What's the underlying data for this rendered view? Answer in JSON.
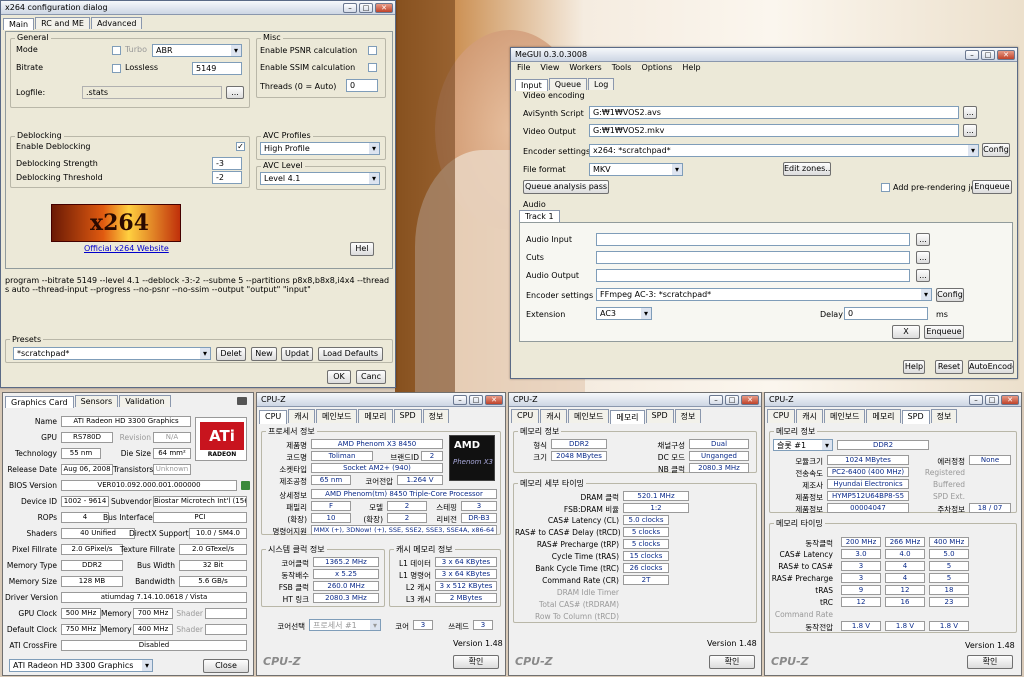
{
  "x264": {
    "title": "x264 configuration dialog",
    "tabs": [
      "Main",
      "RC and ME",
      "Advanced"
    ],
    "general": "General",
    "mode_label": "Mode",
    "turbo": "Turbo",
    "mode_value": "ABR",
    "bitrate_label": "Bitrate",
    "lossless": "Lossless",
    "bitrate_value": "5149",
    "logfile_label": "Logfile:",
    "logfile_value": ".stats",
    "browse": "...",
    "misc": "Misc",
    "psnr": "Enable PSNR calculation",
    "ssim": "Enable SSIM calculation",
    "threads_label": "Threads (0 = Auto)",
    "threads_value": "0",
    "deblocking": "Deblocking",
    "enable_deblock": "Enable Deblocking",
    "strength_label": "Deblocking Strength",
    "strength_value": "-3",
    "threshold_label": "Deblocking Threshold",
    "threshold_value": "-2",
    "avc_profiles": "AVC Profiles",
    "profile_value": "High Profile",
    "avc_level": "AVC Level",
    "level_value": "Level 4.1",
    "logo": "x264",
    "website": "Official x264 Website",
    "help": "Hel",
    "cmdline": "program --bitrate 5149 --level 4.1 --deblock -3:-2 --subme 5 --partitions p8x8,b8x8,i4x4 --threads auto --thread-input --progress --no-psnr --no-ssim --output \"output\" \"input\"",
    "presets": "Presets",
    "preset_value": "*scratchpad*",
    "delete": "Delet",
    "new": "New",
    "update": "Updat",
    "load_defaults": "Load Defaults",
    "ok": "OK",
    "cancel": "Canc"
  },
  "megui": {
    "title": "MeGUI 0.3.0.3008",
    "menu": [
      "File",
      "View",
      "Workers",
      "Tools",
      "Options",
      "Help"
    ],
    "tabs": [
      "Input",
      "Queue",
      "Log"
    ],
    "video_encoding": "Video encoding",
    "avisynth_label": "AviSynth Script",
    "avisynth_value": "G:₩1₩VOS2.avs",
    "video_output_label": "Video Output",
    "video_output_value": "G:₩1₩VOS2.mkv",
    "encoder_label": "Encoder settings",
    "encoder_value": "x264: *scratchpad*",
    "config": "Config",
    "format_label": "File format",
    "format_value": "MKV",
    "edit_zones": "Edit zones...",
    "queue_analysis": "Queue analysis pass",
    "add_prerender": "Add pre-rendering job",
    "enqueue": "Enqueue",
    "audio": "Audio",
    "track": "Track 1",
    "audio_input_label": "Audio Input",
    "cuts_label": "Cuts",
    "audio_output_label": "Audio Output",
    "audio_encoder_label": "Encoder settings",
    "audio_encoder_value": "FFmpeg AC-3: *scratchpad*",
    "audio_config": "Config",
    "extension_label": "Extension",
    "extension_value": "AC3",
    "delay_label": "Delay",
    "delay_value": "0",
    "ms": "ms",
    "x": "X",
    "audio_enqueue": "Enqueue",
    "help": "Help",
    "reset": "Reset",
    "autoencode": "AutoEncode",
    "browse": "..."
  },
  "gpuz": {
    "tabs": [
      "Graphics Card",
      "Sensors",
      "Validation"
    ],
    "rows": [
      [
        "Name",
        "ATI Radeon HD 3300 Graphics"
      ],
      [
        "GPU",
        "RS780D"
      ],
      [
        "Revision",
        "N/A"
      ],
      [
        "Technology",
        "55 nm"
      ],
      [
        "Die Size",
        "64 mm²"
      ],
      [
        "Release Date",
        "Aug 06, 2008"
      ],
      [
        "Transistors",
        "Unknown"
      ],
      [
        "BIOS Version",
        "VER010.092.000.001.000000"
      ],
      [
        "Device ID",
        "1002 - 9614"
      ],
      [
        "Subvendor",
        "Biostar Microtech Int'l (1565)"
      ],
      [
        "ROPs",
        "4"
      ],
      [
        "Bus Interface",
        "PCI"
      ],
      [
        "Shaders",
        "40 Unified"
      ],
      [
        "DirectX Support",
        "10.0 / SM4.0"
      ],
      [
        "Pixel Fillrate",
        "2.0 GPixel/s"
      ],
      [
        "Texture Fillrate",
        "2.0 GTexel/s"
      ],
      [
        "Memory Type",
        "DDR2"
      ],
      [
        "Bus Width",
        "32 Bit"
      ],
      [
        "Memory Size",
        "128 MB"
      ],
      [
        "Bandwidth",
        "5.6 GB/s"
      ],
      [
        "Driver Version",
        "atiumdag 7.14.10.0618 / Vista"
      ],
      [
        "GPU Clock",
        "500 MHz"
      ],
      [
        "Memory",
        "700 MHz"
      ],
      [
        "Shader",
        ""
      ],
      [
        "Default Clock",
        "750 MHz"
      ],
      [
        "Memory2",
        "400 MHz"
      ],
      [
        "Shader2",
        ""
      ],
      [
        "ATI CrossFire",
        "Disabled"
      ]
    ],
    "labels": {
      "memory": "Memory",
      "shader": "Shader"
    },
    "ati_logo": "ATi",
    "ati_sub": "RADEON",
    "select_value": "ATI Radeon HD 3300 Graphics",
    "close": "Close"
  },
  "cpuz1": {
    "title": "CPU-Z",
    "tabs": [
      "CPU",
      "캐시",
      "메인보드",
      "메모리",
      "SPD",
      "정보"
    ],
    "proc_group": "프로세서 정보",
    "name_l": "제품명",
    "name_v": "AMD Phenom X3 8450",
    "code_l": "코드명",
    "code_v": "Toliman",
    "brand_l": "브랜드ID",
    "brand_v": "2",
    "socket_l": "소켓타입",
    "socket_v": "Socket AM2+ (940)",
    "process_l": "제조공정",
    "process_v": "65 nm",
    "voltage_l": "코어전압",
    "voltage_v": "1.264 V",
    "spec_l": "상세정보",
    "spec_v": "AMD Phenom(tm) 8450 Triple-Core Processor",
    "family_l": "패밀리",
    "family_v": "F",
    "model_l": "모델",
    "model_v": "2",
    "stepping_l": "스테핑",
    "stepping_v": "3",
    "extfam_l": "(확장)",
    "extfam_v": "10",
    "extmod_l": "(확장)",
    "extmod_v": "2",
    "rev_l": "리비전",
    "rev_v": "DR-B3",
    "instr_l": "명령어지원",
    "instr_v": "MMX (+), 3DNow! (+), SSE, SSE2, SSE3, SSE4A, x86-64",
    "clock_group": "시스템 클럭 정보",
    "core_l": "코어클럭",
    "core_v": "1365.2 MHz",
    "mult_l": "동작배수",
    "mult_v": "x 5.25",
    "fsb_l": "FSB 클럭",
    "fsb_v": "260.0 MHz",
    "ht_l": "HT 링크",
    "ht_v": "2080.3 MHz",
    "cache_group": "캐시 메모리 정보",
    "l1d_l": "L1 데이터",
    "l1d_v": "3 x 64 KBytes",
    "l1i_l": "L1 명령어",
    "l1i_v": "3 x 64 KBytes",
    "l2_l": "L2 캐시",
    "l2_v": "3 x 512 KBytes",
    "l3_l": "L3 캐시",
    "l3_v": "2 MBytes",
    "coresel_l": "코어선택",
    "coresel_v": "프로세서 #1",
    "cores_l": "코어",
    "cores_v": "3",
    "threads_l": "쓰레드",
    "threads_v": "3",
    "version": "Version 1.48",
    "ok": "확인",
    "logo": "CPU-Z",
    "amd": "AMD",
    "phenom": "Phenom X3"
  },
  "cpuz2": {
    "title": "CPU-Z",
    "tabs": [
      "CPU",
      "캐시",
      "메인보드",
      "메모리",
      "SPD",
      "정보"
    ],
    "gen_group": "메모리 정보",
    "type_l": "형식",
    "type_v": "DDR2",
    "chan_l": "채널구성",
    "chan_v": "Dual",
    "size_l": "크기",
    "size_v": "2048 MBytes",
    "dc_l": "DC 모드",
    "dc_v": "Unganged",
    "nb_l": "NB 클럭",
    "nb_v": "2080.3 MHz",
    "tim_group": "메모리 세부 타이밍",
    "rows": [
      [
        "DRAM 클럭",
        "520.1 MHz"
      ],
      [
        "FSB:DRAM 비율",
        "1:2"
      ],
      [
        "CAS# Latency (CL)",
        "5.0 clocks"
      ],
      [
        "RAS# to CAS# Delay (tRCD)",
        "5 clocks"
      ],
      [
        "RAS# Precharge (tRP)",
        "5 clocks"
      ],
      [
        "Cycle Time (tRAS)",
        "15 clocks"
      ],
      [
        "Bank Cycle Time (tRC)",
        "26 clocks"
      ],
      [
        "Command Rate (CR)",
        "2T"
      ],
      [
        "DRAM Idle Timer",
        ""
      ],
      [
        "Total CAS# (tRDRAM)",
        ""
      ],
      [
        "Row To Column (tRCD)",
        ""
      ]
    ],
    "version": "Version 1.48",
    "ok": "확인",
    "logo": "CPU-Z"
  },
  "cpuz3": {
    "title": "CPU-Z",
    "tabs": [
      "CPU",
      "캐시",
      "메인보드",
      "메모리",
      "SPD",
      "정보"
    ],
    "slot_group": "메모리 정보",
    "slot_v": "슬롯 #1",
    "slot_type": "DDR2",
    "size_l": "모듈크기",
    "size_v": "1024 MBytes",
    "speed_l": "전송속도",
    "speed_v": "PC2-6400 (400 MHz)",
    "mfr_l": "제조사",
    "mfr_v": "Hyundai Electronics",
    "part_l": "제품정보",
    "part_v": "HYMP512U64BP8-S5",
    "serial_l": "제품정보",
    "serial_v": "00004047",
    "ecc_l": "에러정정",
    "ecc_v": "None",
    "reg_l": "Registered",
    "buf_l": "Buffered",
    "spd_l": "SPD Ext.",
    "week_l": "주차정보",
    "week_v": "18 / 07",
    "tim_group": "메모리 타이밍",
    "freq": [
      "200 MHz",
      "266 MHz",
      "400 MHz"
    ],
    "trows": [
      [
        "동작클럭",
        ""
      ],
      [
        "CAS# Latency",
        "3.0",
        "4.0",
        "5.0"
      ],
      [
        "RAS# to CAS#",
        "3",
        "4",
        "5"
      ],
      [
        "RAS# Precharge",
        "3",
        "4",
        "5"
      ],
      [
        "tRAS",
        "9",
        "12",
        "18"
      ],
      [
        "tRC",
        "12",
        "16",
        "23"
      ],
      [
        "Command Rate",
        "",
        "",
        ""
      ],
      [
        "동작전압",
        "1.8 V",
        "1.8 V",
        "1.8 V"
      ]
    ],
    "version": "Version 1.48",
    "ok": "확인",
    "logo": "CPU-Z"
  }
}
